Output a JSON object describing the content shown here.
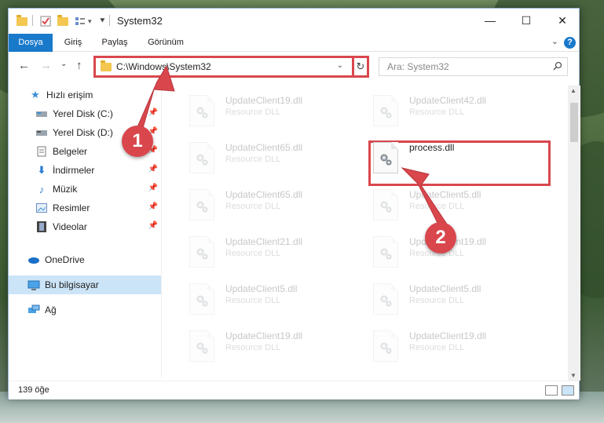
{
  "window": {
    "title": "System32",
    "controls": {
      "minimize": "—",
      "maximize": "☐",
      "close": "✕"
    }
  },
  "ribbon": {
    "tabs": [
      "Dosya",
      "Giriş",
      "Paylaş",
      "Görünüm"
    ],
    "help": "?"
  },
  "nav": {
    "back": "←",
    "forward": "→",
    "recent": "⌄",
    "up": "↑",
    "address": "C:\\Windows\\System32",
    "refresh": "↻",
    "search_placeholder": "Ara: System32"
  },
  "sidebar": {
    "items": [
      {
        "label": "Hızlı erişim",
        "icon": "star-icon"
      },
      {
        "label": "Yerel Disk (C:)",
        "icon": "drive-icon"
      },
      {
        "label": "Yerel Disk (D:)",
        "icon": "drive-icon"
      },
      {
        "label": "Belgeler",
        "icon": "documents-icon"
      },
      {
        "label": "İndirmeler",
        "icon": "download-icon"
      },
      {
        "label": "Müzik",
        "icon": "music-icon"
      },
      {
        "label": "Resimler",
        "icon": "pictures-icon"
      },
      {
        "label": "Videolar",
        "icon": "video-icon"
      },
      {
        "label": "OneDrive",
        "icon": "cloud-icon"
      },
      {
        "label": "Bu bilgisayar",
        "icon": "computer-icon"
      },
      {
        "label": "Ağ",
        "icon": "network-icon"
      }
    ]
  },
  "files": [
    {
      "name": "UpdateClient19.dll",
      "type": "Resource DLL"
    },
    {
      "name": "UpdateClient42.dll",
      "type": "Resource DLL"
    },
    {
      "name": "UpdateClient65.dll",
      "type": "Resource DLL"
    },
    {
      "name": "process.dll",
      "type": ""
    },
    {
      "name": "UpdateClient65.dll",
      "type": "Resource DLL"
    },
    {
      "name": "UpdateClient5.dll",
      "type": "Resource DLL"
    },
    {
      "name": "UpdateClient21.dll",
      "type": "Resource DLL"
    },
    {
      "name": "UpdateClient19.dll",
      "type": "Resource DLL"
    },
    {
      "name": "UpdateClient5.dll",
      "type": "Resource DLL"
    },
    {
      "name": "UpdateClient5.dll",
      "type": "Resource DLL"
    },
    {
      "name": "UpdateClient19.dll",
      "type": "Resource DLL"
    },
    {
      "name": "UpdateClient19.dll",
      "type": "Resource DLL"
    }
  ],
  "status": {
    "count": "139 öğe"
  },
  "annotations": {
    "step1": "1",
    "step2": "2"
  },
  "colors": {
    "accent": "#1979ca",
    "highlight": "#d9474d",
    "selected": "#cce4f7"
  }
}
